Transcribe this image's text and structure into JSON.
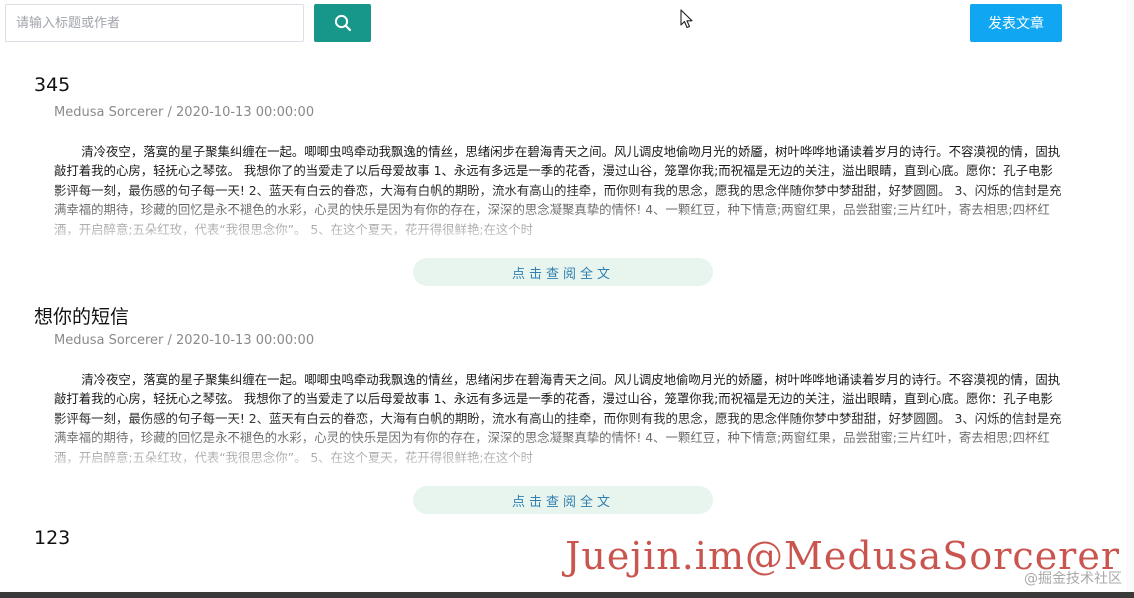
{
  "search": {
    "placeholder": "请输入标题或作者",
    "value": ""
  },
  "toolbar": {
    "search_icon": "search-icon",
    "publish_label": "发表文章",
    "colors": {
      "search_button": "#16978a",
      "publish_button": "#10a6f2"
    }
  },
  "articles": [
    {
      "title": "345",
      "meta": "Medusa Sorcerer / 2020-10-13 00:00:00",
      "body": "清冷夜空，落寞的星子聚集纠缠在一起。唧唧虫鸣牵动我飘逸的情丝，思绪闲步在碧海青天之间。风儿调皮地偷吻月光的娇靥，树叶哗哗地诵读着岁月的诗行。不容漠视的情，固执敲打着我的心房，轻抚心之琴弦。 我想你了的当爱走了以后母爱故事 1、永远有多远是一季的花香，漫过山谷，笼罩你我;而祝福是无边的关注，溢出眼睛，直到心底。愿你：孔子电影影评每一刻，最伤感的句子每一天! 2、蓝天有白云的眷恋，大海有白帆的期盼，流水有高山的挂牵，而你则有我的思念，愿我的思念伴随你梦中梦甜甜，好梦圆圆。 3、闪烁的信封是充满幸福的期待，珍藏的回忆是永不褪色的水彩，心灵的快乐是因为有你的存在，深深的思念凝聚真挚的情怀! 4、一颗红豆，种下情意;两窗红果，品尝甜蜜;三片红叶，寄去相思;四杯红酒，开启醉意;五朵红玫，代表“我很思念你”。 5、在这个夏天，花开得很鲜艳;在这个时",
      "read_more": "点击查阅全文"
    },
    {
      "title": "想你的短信",
      "meta": "Medusa Sorcerer / 2020-10-13 00:00:00",
      "body": "清冷夜空，落寞的星子聚集纠缠在一起。唧唧虫鸣牵动我飘逸的情丝，思绪闲步在碧海青天之间。风儿调皮地偷吻月光的娇靥，树叶哗哗地诵读着岁月的诗行。不容漠视的情，固执敲打着我的心房，轻抚心之琴弦。 我想你了的当爱走了以后母爱故事 1、永远有多远是一季的花香，漫过山谷，笼罩你我;而祝福是无边的关注，溢出眼睛，直到心底。愿你：孔子电影影评每一刻，最伤感的句子每一天! 2、蓝天有白云的眷恋，大海有白帆的期盼，流水有高山的挂牵，而你则有我的思念，愿我的思念伴随你梦中梦甜甜，好梦圆圆。 3、闪烁的信封是充满幸福的期待，珍藏的回忆是永不褪色的水彩，心灵的快乐是因为有你的存在，深深的思念凝聚真挚的情怀! 4、一颗红豆，种下情意;两窗红果，品尝甜蜜;三片红叶，寄去相思;四杯红酒，开启醉意;五朵红玫，代表“我很思念你”。 5、在这个夏天，花开得很鲜艳;在这个时",
      "read_more": "点击查阅全文"
    },
    {
      "title": "123"
    }
  ],
  "watermark": {
    "text": "Juejin.im@MedusaSorcerer",
    "community": "@掘金技术社区"
  }
}
